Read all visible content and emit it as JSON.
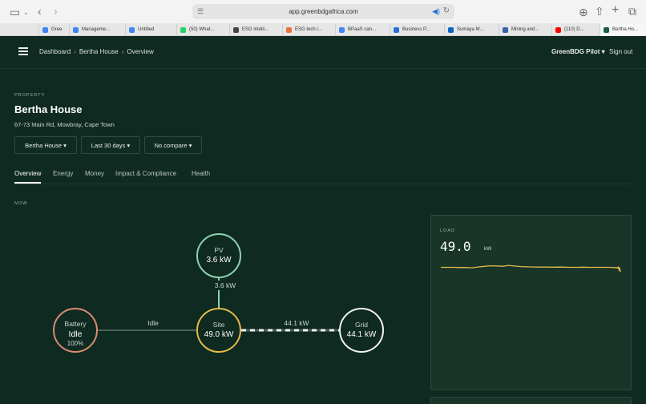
{
  "browser": {
    "url": "app.greenbdgafrica.com",
    "tabs": [
      {
        "label": "Gree",
        "color": "#4285f4"
      },
      {
        "label": "Manageme...",
        "color": "#4285f4"
      },
      {
        "label": "Untitled",
        "color": "#4285f4"
      },
      {
        "label": "(50) What...",
        "color": "#25d366"
      },
      {
        "label": "ESG intelli...",
        "color": "#444444"
      },
      {
        "label": "ESG tech i...",
        "color": "#e8743b"
      },
      {
        "label": "BPaaS can...",
        "color": "#4285f4"
      },
      {
        "label": "Business P...",
        "color": "#2a6fd6"
      },
      {
        "label": "Sumaya M...",
        "color": "#0a66c2"
      },
      {
        "label": "Mining and...",
        "color": "#3a5fa8"
      },
      {
        "label": "(110) D...",
        "color": "#ff0000"
      },
      {
        "label": "Bertha Ho...",
        "color": "#1f5d43"
      }
    ]
  },
  "header": {
    "breadcrumb": [
      "Dashboard",
      "Bertha House",
      "Overview"
    ],
    "user": "GreenBDG Pilot ▾",
    "signout": "Sign out"
  },
  "property": {
    "eyebrow": "PROPERTY",
    "name": "Bertha House",
    "address": "67-73 Main Rd, Mowbray, Cape Town"
  },
  "filters": {
    "property": "Bertha House ▾",
    "range": "Last 30 days ▾",
    "compare": "No compare ▾"
  },
  "nav": {
    "tabs": [
      "Overview",
      "Energy",
      "Money",
      "Impact & Compliance",
      "Health"
    ],
    "active": "Overview"
  },
  "flow": {
    "now_label": "NOW",
    "pv": {
      "name": "PV",
      "value": "3.6 kW",
      "flow": "3.6 kW",
      "color": "#8fd1b3"
    },
    "battery": {
      "name": "Battery",
      "state": "Idle",
      "soc": "100%",
      "flow": "Idle",
      "color": "#d98b72"
    },
    "site": {
      "name": "Site",
      "value": "49.0 kW",
      "color": "#e6b94a"
    },
    "grid": {
      "name": "Grid",
      "value": "44.1 kW",
      "flow": "44.1 kW",
      "color": "#f2f2f2"
    }
  },
  "load": {
    "label": "LOAD",
    "value": "49.0",
    "unit": "kW",
    "line_color": "#e6b94a"
  },
  "chart_data": {
    "type": "line",
    "title": "",
    "series": [
      {
        "values": [
          49,
          49,
          49,
          48.8,
          48.9,
          48.6,
          49.3,
          49.8,
          50.3,
          50.1,
          49.9,
          50.6,
          50.0,
          49.6,
          49.4,
          49.3,
          49.2,
          49.2,
          49.1,
          49.2,
          49.1,
          49.0,
          49.0,
          49.1,
          49.0,
          49.0,
          49.0,
          49.0,
          48.9,
          48.2
        ]
      }
    ],
    "ylim": [
      40,
      60
    ],
    "grid": false,
    "legend": "none"
  }
}
